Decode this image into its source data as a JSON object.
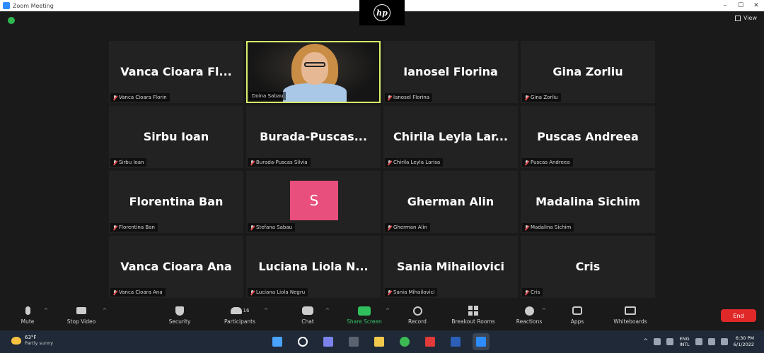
{
  "window": {
    "title": "Zoom Meeting",
    "controls": [
      "–",
      "☐",
      "✕"
    ],
    "view_label": "View"
  },
  "bezel_logo": "hp",
  "participants": [
    {
      "display": "Vanca Cioara Fl...",
      "label": "Vanca Cioara Florin",
      "muted": true,
      "type": "name"
    },
    {
      "display": "",
      "label": "Doina Sabau",
      "muted": false,
      "type": "video"
    },
    {
      "display": "Ianosel Florina",
      "label": "Ianosel Florina",
      "muted": true,
      "type": "name"
    },
    {
      "display": "Gina Zorliu",
      "label": "Gina Zorliu",
      "muted": true,
      "type": "name"
    },
    {
      "display": "Sirbu Ioan",
      "label": "Sirbu Ioan",
      "muted": true,
      "type": "name"
    },
    {
      "display": "Burada-Puscas...",
      "label": "Burada-Puscas Silvia",
      "muted": true,
      "type": "name"
    },
    {
      "display": "Chirila Leyla Lar...",
      "label": "Chirila Leyla Larisa",
      "muted": true,
      "type": "name"
    },
    {
      "display": "Puscas Andreea",
      "label": "Puscas Andreea",
      "muted": true,
      "type": "name"
    },
    {
      "display": "Florentina Ban",
      "label": "Florentina Ban",
      "muted": true,
      "type": "name"
    },
    {
      "display": "S",
      "label": "Stefana Sabau",
      "muted": true,
      "type": "avatar"
    },
    {
      "display": "Gherman Alin",
      "label": "Gherman Alin",
      "muted": true,
      "type": "name"
    },
    {
      "display": "Madalina Sichim",
      "label": "Madalina Sichim",
      "muted": true,
      "type": "name"
    },
    {
      "display": "Vanca Cioara Ana",
      "label": "Vanca Cioara Ana",
      "muted": true,
      "type": "name"
    },
    {
      "display": "Luciana Liola N...",
      "label": "Luciana Liola Negru",
      "muted": true,
      "type": "name"
    },
    {
      "display": "Sania Mihailovici",
      "label": "Sania Mihailovici",
      "muted": true,
      "type": "name"
    },
    {
      "display": "Cris",
      "label": "Cris",
      "muted": true,
      "type": "name"
    }
  ],
  "toolbar": {
    "mute": "Mute",
    "stop_video": "Stop Video",
    "security": "Security",
    "participants": "Participants",
    "participants_count": "16",
    "chat": "Chat",
    "share_screen": "Share Screen",
    "record": "Record",
    "breakout_rooms": "Breakout Rooms",
    "reactions": "Reactions",
    "apps": "Apps",
    "whiteboards": "Whiteboards",
    "end": "End"
  },
  "taskbar": {
    "temp": "63°F",
    "weather": "Partly sunny",
    "lang_top": "ENG",
    "lang_bottom": "INTL",
    "time": "6:30 PM",
    "date": "6/1/2022"
  },
  "colors": {
    "tile_bg": "#222222",
    "active_border": "#d8ef6a",
    "avatar_bg": "#e84f7c",
    "share_green": "#2fbf5d",
    "end_red": "#e02828"
  }
}
